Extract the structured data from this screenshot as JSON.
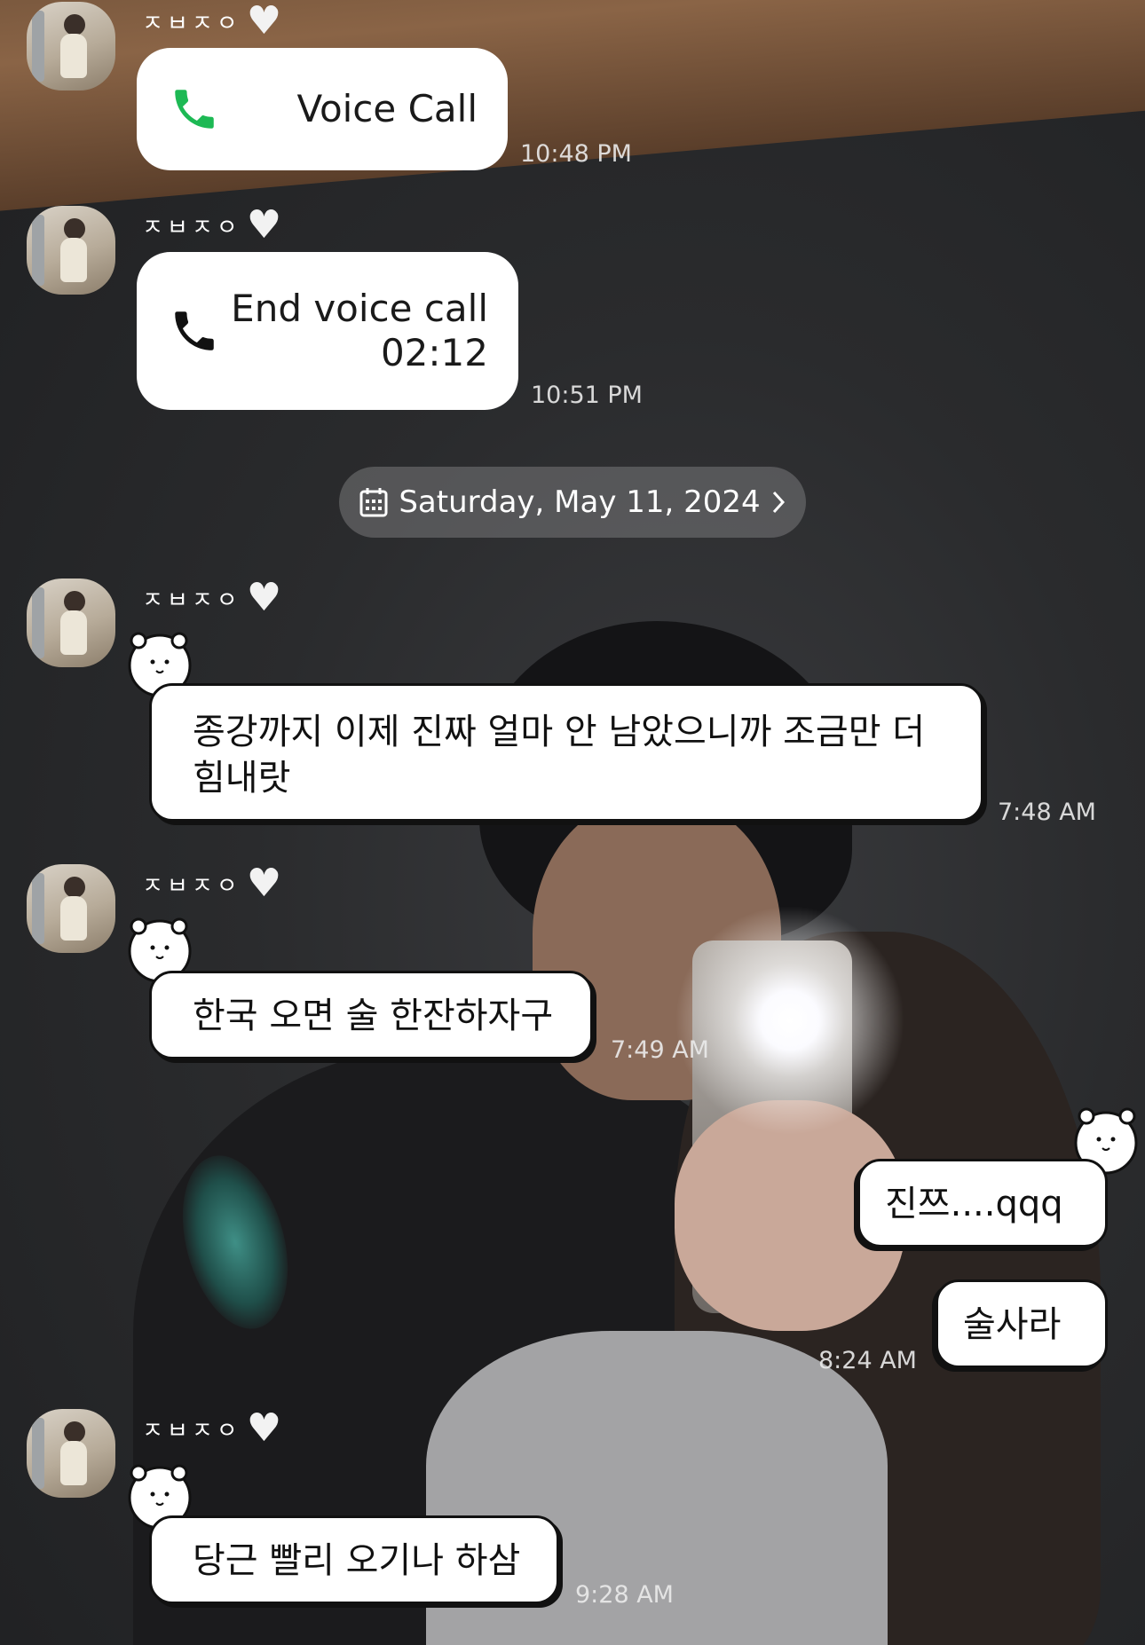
{
  "chat": {
    "contact_name": "ㅈㅂㅈㅇ",
    "messages": [
      {
        "type": "call",
        "text": "Voice Call",
        "time": "10:48 PM",
        "icon": "phone-icon-green"
      },
      {
        "type": "call",
        "text": "End voice call",
        "duration": "02:12",
        "time": "10:51 PM",
        "icon": "phone-icon-black"
      },
      {
        "type": "date",
        "text": "Saturday, May 11, 2024",
        "icon": "calendar-icon"
      },
      {
        "type": "text",
        "from": "contact",
        "text": "종강까지 이제 진짜 얼마 안 남았으니까 조금만 더 힘내랏",
        "time": "7:48 AM"
      },
      {
        "type": "text",
        "from": "contact",
        "text": "한국 오면 술 한잔하자구",
        "time": "7:49 AM"
      },
      {
        "type": "text",
        "from": "me",
        "text": "진쯔....qqq"
      },
      {
        "type": "text",
        "from": "me",
        "text": "술사라",
        "time": "8:24 AM"
      },
      {
        "type": "text",
        "from": "contact",
        "text": "당근 빨리 오기나 하삼",
        "time": "9:28 AM"
      }
    ]
  },
  "colors": {
    "call_green": "#1db954",
    "bubble_bg": "#ffffff",
    "outline": "#111111"
  }
}
